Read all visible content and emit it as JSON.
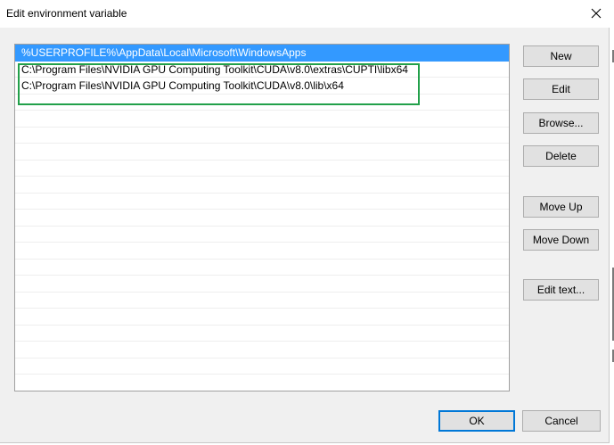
{
  "window": {
    "title": "Edit environment variable",
    "close_icon": "close-icon"
  },
  "list": {
    "items": [
      {
        "text": "%USERPROFILE%\\AppData\\Local\\Microsoft\\WindowsApps",
        "selected": true
      },
      {
        "text": "C:\\Program Files\\NVIDIA GPU Computing Toolkit\\CUDA\\v8.0\\extras\\CUPTI\\libx64",
        "selected": false
      },
      {
        "text": "C:\\Program Files\\NVIDIA GPU Computing Toolkit\\CUDA\\v8.0\\lib\\x64",
        "selected": false
      },
      {
        "text": "",
        "selected": false
      },
      {
        "text": "",
        "selected": false
      },
      {
        "text": "",
        "selected": false
      },
      {
        "text": "",
        "selected": false
      },
      {
        "text": "",
        "selected": false
      },
      {
        "text": "",
        "selected": false
      },
      {
        "text": "",
        "selected": false
      },
      {
        "text": "",
        "selected": false
      },
      {
        "text": "",
        "selected": false
      },
      {
        "text": "",
        "selected": false
      },
      {
        "text": "",
        "selected": false
      },
      {
        "text": "",
        "selected": false
      },
      {
        "text": "",
        "selected": false
      },
      {
        "text": "",
        "selected": false
      },
      {
        "text": "",
        "selected": false
      },
      {
        "text": "",
        "selected": false
      },
      {
        "text": "",
        "selected": false
      },
      {
        "text": "",
        "selected": false
      }
    ],
    "highlight_color": "#22a04a",
    "selection_color": "#3399ff"
  },
  "buttons": {
    "new": "New",
    "edit": "Edit",
    "browse": "Browse...",
    "delete": "Delete",
    "move_up": "Move Up",
    "move_down": "Move Down",
    "edit_text": "Edit text...",
    "ok": "OK",
    "cancel": "Cancel"
  }
}
